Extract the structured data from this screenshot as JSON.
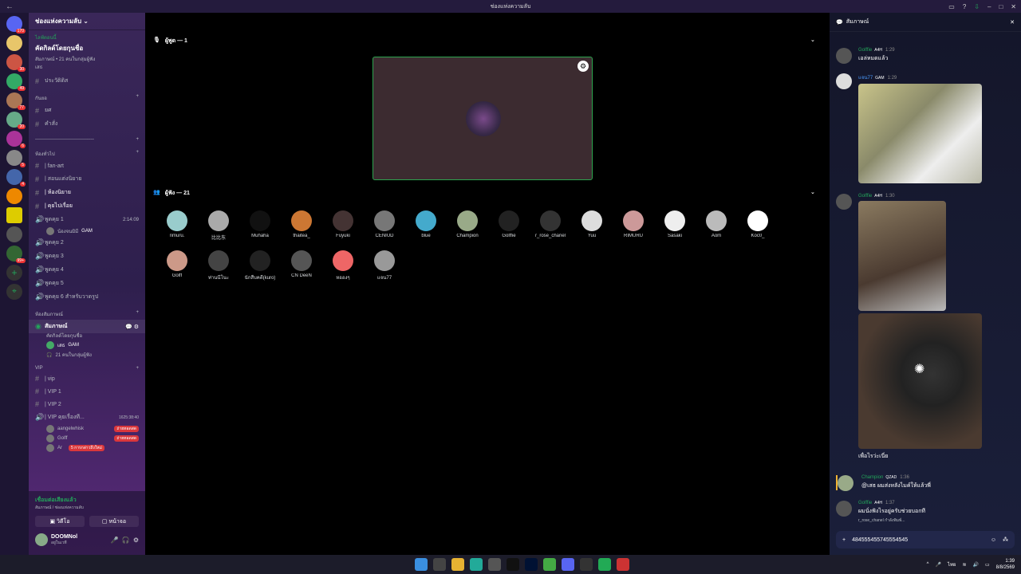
{
  "window": {
    "title": "ช่องแห่งความลับ"
  },
  "guilds": {
    "badges": [
      "170",
      "",
      "30",
      "49",
      "77",
      "20",
      "6",
      "5",
      "4",
      "",
      "",
      "",
      "99+"
    ]
  },
  "sidebar": {
    "server_name": "ช่องแห่งความลับ",
    "event_live": "ไลฟ์ตอนนี้",
    "event_title": "คัดกิลด์โดยกุนชื่อ",
    "event_sub": "สัมภาษณ์ • 21 คนในกลุ่มผู้ฟัง",
    "event_user": "เสธ",
    "ch_history": "ประวัติดิส",
    "cat_rules": "กันยอ",
    "ch_rules": "ยศ",
    "ch_commands": "คำสั่ง",
    "divider": "-------------------------------------",
    "cat_general": "ห้องทั่วไป",
    "ch_fanart": "| fan-art",
    "ch_novel_submit": "| สอนแต่งนิยาย",
    "ch_novel": "| ห้องนิยาย",
    "ch_talk": "| คุยไปเรื่อย",
    "vc1": "พูดคุย 1",
    "vc1_time": "2:14:09",
    "vc1_user": "น้องจนมิมี",
    "vc1_tag": "GAM",
    "vc2": "พูดคุย 2",
    "vc3": "พูดคุย 3",
    "vc4": "พูดคุย 4",
    "vc5": "พูดคุย 5",
    "vc6": "พูดคุย 6 สำหรับวาดรูป",
    "cat_interview": "ห้องสัมภาษณ์",
    "stage_name": "สัมภาษณ์",
    "stage_sub": "คัดกิลด์โดยกุนชื่อ",
    "stage_user": "เสธ",
    "stage_user_tag": "GAM",
    "stage_listeners": "21 คนในกลุ่มผู้ฟัง",
    "cat_vip": "VIP",
    "ch_vip": "| vip",
    "ch_vip1": "| VIP 1",
    "ch_vip2": "| VIP 2",
    "ch_vipvc": "| VIP คุยเรื่องที...",
    "ch_vipvc_time": "1625:38:40",
    "vip_u1": "aangelwhisk",
    "vip_u2": "Golff",
    "vip_u3": "Ar",
    "live_badge": "ถ่ายทอดสด",
    "new_msgs": "5 การกล่าวถึงใหม่"
  },
  "voice": {
    "status": "เชื่อมต่อเสียงแล้ว",
    "location": "สัมภาษณ์ / ช่องแห่งความลับ",
    "video": "วิดีโอ",
    "screen": "หน้าจอ",
    "user": "DOOMNol",
    "user_status": "อยู่ในเวที"
  },
  "stage": {
    "speakers_label": "ผู้พูด — 1",
    "audience_label": "ผู้ฟัง — 21"
  },
  "audience": [
    {
      "name": "rimuru.",
      "color": "#9cc"
    },
    {
      "name": "比比东",
      "color": "#aaa"
    },
    {
      "name": "Muhaha",
      "color": "#111"
    },
    {
      "name": "thaitea_",
      "color": "#c73"
    },
    {
      "name": "Fuyuki",
      "color": "#433"
    },
    {
      "name": "CENIUD",
      "color": "#777"
    },
    {
      "name": "blue",
      "color": "#4ac"
    },
    {
      "name": "Champion",
      "color": "#9a8"
    },
    {
      "name": "Golffie",
      "color": "#222"
    },
    {
      "name": "r_rose_chanel",
      "color": "#333"
    },
    {
      "name": "Yuu",
      "color": "#ddd"
    },
    {
      "name": "RIMURU",
      "color": "#c99"
    },
    {
      "name": "Sasaki",
      "color": "#eee"
    },
    {
      "name": "Aom",
      "color": "#bbb"
    },
    {
      "name": "Koc0_",
      "color": "#fff"
    },
    {
      "name": "Golff",
      "color": "#c98"
    },
    {
      "name": "ท่านนีโนะ",
      "color": "#444"
    },
    {
      "name": "นักสืบคดี(kuro)",
      "color": "#222"
    },
    {
      "name": "CN DeeN",
      "color": "#555"
    },
    {
      "name": "หอองๆ",
      "color": "#e66"
    },
    {
      "name": "แจน77",
      "color": "#999"
    }
  ],
  "chat": {
    "title": "สัมภาษณ์",
    "m1_name": "Golffie",
    "m1_tag": "A4H",
    "m1_time": "1:29",
    "m1_text": "เอล่หมดแล้ว",
    "m2_name": "แจน77",
    "m2_tag": "GAM",
    "m2_time": "1:29",
    "m3_name": "Golffie",
    "m3_tag": "A4H",
    "m3_time": "1:30",
    "m3_text": "เพื่อไรว่ะเนี่ย",
    "m4_name": "Champion",
    "m4_tag": "QZAD",
    "m4_time": "1:36",
    "m4_text": "@เสธ ผมส่งหลังไมค์ให้แล้วพี่",
    "m5_name": "Golffie",
    "m5_tag": "A4H",
    "m5_time": "1:37",
    "m5_text": "ผมนั่งฟังไรอยู่ครับช่วยบอกที",
    "typing": "r_rose_chanel กำลังพิมพ์...",
    "composer_value": "48455545574555454​5"
  },
  "taskbar": {
    "time": "1:39",
    "date": "8/8/2569",
    "lang": "ไทย"
  }
}
